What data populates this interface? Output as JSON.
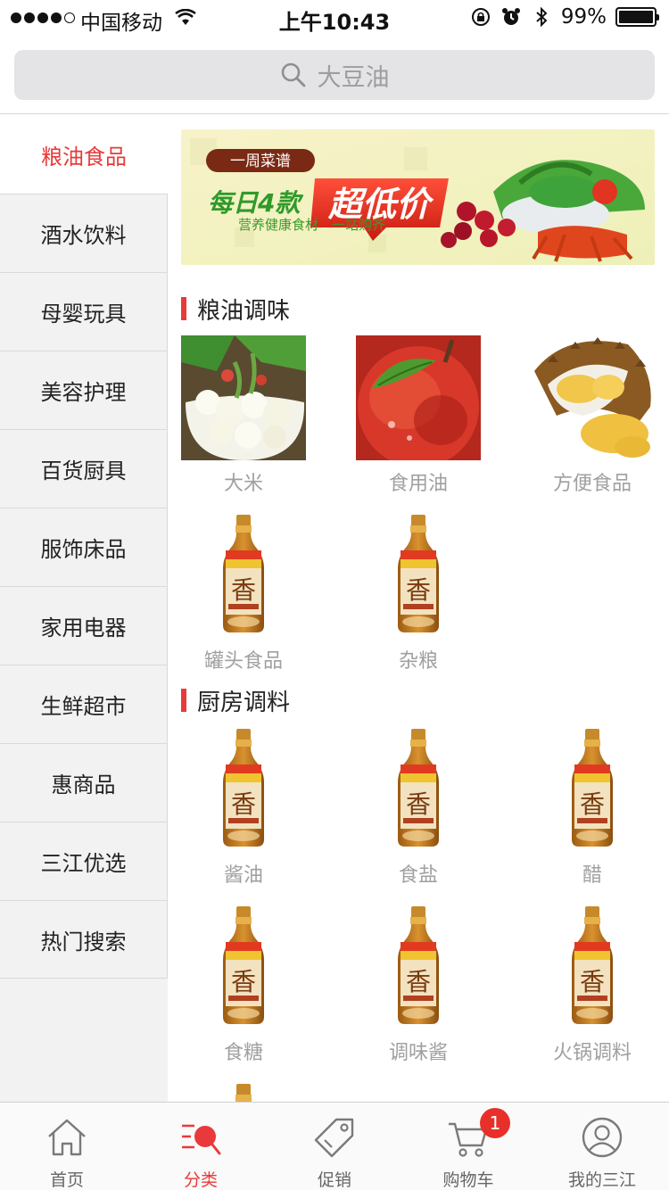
{
  "status_bar": {
    "carrier": "中国移动",
    "time": "上午10:43",
    "battery": "99%",
    "battery_level": 0.99
  },
  "search": {
    "placeholder": "大豆油"
  },
  "sidebar": {
    "items": [
      {
        "label": "粮油食品",
        "active": true
      },
      {
        "label": "酒水饮料"
      },
      {
        "label": "母婴玩具"
      },
      {
        "label": "美容护理"
      },
      {
        "label": "百货厨具"
      },
      {
        "label": "服饰床品"
      },
      {
        "label": "家用电器"
      },
      {
        "label": "生鲜超市"
      },
      {
        "label": "惠商品"
      },
      {
        "label": "三江优选"
      },
      {
        "label": "热门搜索"
      }
    ]
  },
  "banner": {
    "tag": "一周菜谱",
    "headline_a": "每日4款",
    "headline_b": "超低价",
    "subline": "营养健康食材　一站购齐"
  },
  "sections": [
    {
      "title": "粮油调味",
      "items": [
        {
          "label": "大米",
          "image": "cauliflower"
        },
        {
          "label": "食用油",
          "image": "apple"
        },
        {
          "label": "方便食品",
          "image": "durian"
        },
        {
          "label": "罐头食品",
          "image": "sesame-oil-bottle"
        },
        {
          "label": "杂粮",
          "image": "sesame-oil-bottle"
        }
      ]
    },
    {
      "title": "厨房调料",
      "items": [
        {
          "label": "酱油",
          "image": "sesame-oil-bottle"
        },
        {
          "label": "食盐",
          "image": "sesame-oil-bottle"
        },
        {
          "label": "醋",
          "image": "sesame-oil-bottle"
        },
        {
          "label": "食糖",
          "image": "sesame-oil-bottle"
        },
        {
          "label": "调味酱",
          "image": "sesame-oil-bottle"
        },
        {
          "label": "火锅调料",
          "image": "sesame-oil-bottle"
        }
      ]
    }
  ],
  "tabbar": {
    "tabs": [
      {
        "label": "首页",
        "icon": "home-icon"
      },
      {
        "label": "分类",
        "icon": "category-search-icon",
        "active": true
      },
      {
        "label": "促销",
        "icon": "tag-icon"
      },
      {
        "label": "购物车",
        "icon": "cart-icon",
        "badge": "1"
      },
      {
        "label": "我的三江",
        "icon": "user-icon"
      }
    ]
  },
  "colors": {
    "accent": "#e83a3a",
    "sidebar_bg": "#f2f2f2",
    "label_gray": "#a0a0a0"
  }
}
